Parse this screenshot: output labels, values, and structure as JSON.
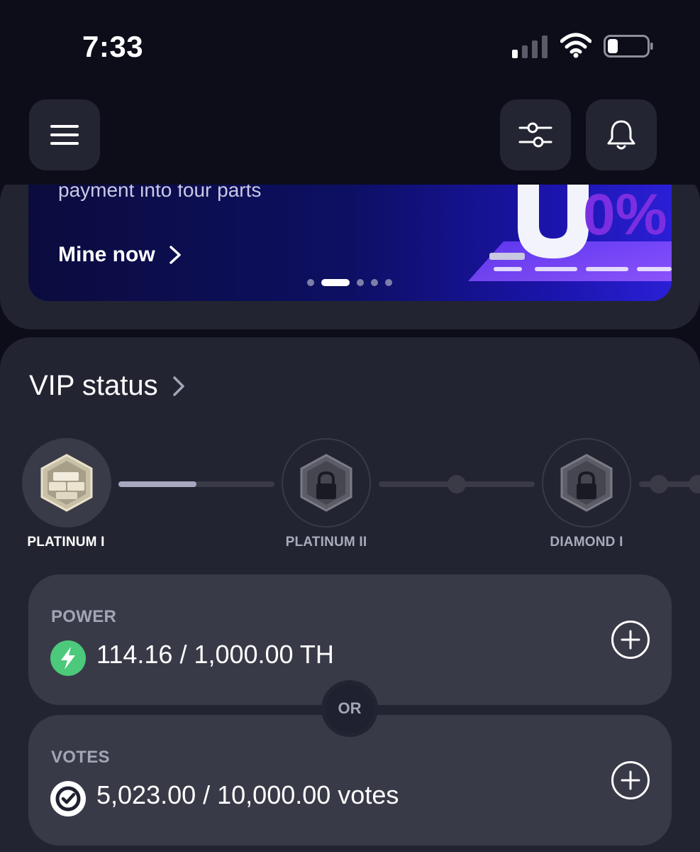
{
  "status_bar": {
    "time": "7:33"
  },
  "banner": {
    "text": "payment into four parts",
    "cta_label": "Mine now",
    "promo_text": "0%",
    "active_slide": 2,
    "slide_count": 5
  },
  "vip": {
    "title": "VIP status",
    "tiers": [
      {
        "label": "PLATINUM I",
        "state": "current"
      },
      {
        "label": "PLATINUM II",
        "state": "locked"
      },
      {
        "label": "DIAMOND I",
        "state": "locked"
      }
    ],
    "progress_to_next": 0.5
  },
  "stats": {
    "power": {
      "label": "POWER",
      "value": "114.16 / 1,000.00 TH"
    },
    "separator": "OR",
    "votes": {
      "label": "VOTES",
      "value": "5,023.00 / 10,000.00 votes"
    }
  },
  "colors": {
    "background": "#0c0d18",
    "card": "#232431",
    "stat_card": "#393a48",
    "power_icon": "#4cc97a",
    "banner_accent": "#2b1fd6"
  }
}
